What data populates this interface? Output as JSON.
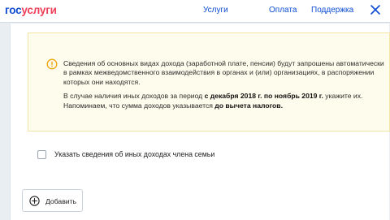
{
  "header": {
    "logo_part1": "гос",
    "logo_part2": "услуги",
    "nav": {
      "services": "Услуги",
      "payment": "Оплата",
      "support": "Поддержка"
    },
    "close_icon": "close-icon"
  },
  "alert": {
    "icon": "info-circle-icon",
    "paragraph1": "Сведения об основных видах дохода (заработной плате, пенсии) будут запрошены автоматически в рамках межведомственного взаимодействия в органах и (или) организациях, в распоряжении которых они находятся.",
    "p2_text1": "В случае наличия иных доходов за период ",
    "p2_bold1": "с декабря 2018 г. по ноябрь 2019 г.",
    "p2_text2": " укажите их. Напоминаем, что сумма доходов указывается ",
    "p2_bold2": "до вычета налогов."
  },
  "family_checkbox": {
    "label": "Указать сведения об иных доходах члена семьи",
    "checked": false
  },
  "add_button": {
    "label": "Добавить",
    "icon": "plus-circle-icon"
  },
  "colors": {
    "brand_blue": "#0d4cd3",
    "brand_red": "#ee3f58",
    "alert_bg": "#fefcec",
    "alert_border": "#f3e5a6",
    "alert_icon": "#f0a30a",
    "page_bg": "#e9eef3"
  }
}
